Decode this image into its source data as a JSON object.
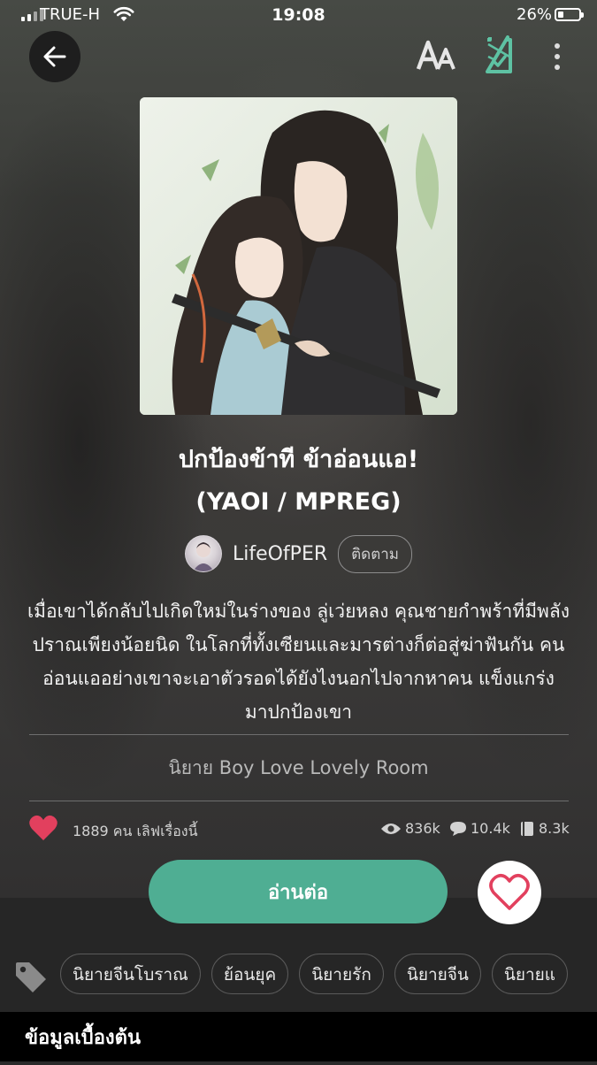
{
  "status_bar": {
    "carrier": "TRUE-H",
    "time": "19:08",
    "battery_percent": "26%",
    "battery_level": 0.26
  },
  "top_bar": {
    "back_icon": "arrow-left-icon",
    "font_icon": "font-size-icon",
    "save_icon": "bookmark-check-icon",
    "more_icon": "more-vertical-icon"
  },
  "book": {
    "title_line1": "ปกป้องข้าที ข้าอ่อนแอ!",
    "title_line2": "(YAOI / MPREG)",
    "author": "LifeOfPER",
    "follow_label": "ติดตาม",
    "synopsis": "เมื่อเขาได้กลับไปเกิดใหม่ในร่างของ ลู่เว่ยหลง คุณชายกำพร้าที่มีพลังปราณเพียงน้อยนิด ในโลกที่ทั้งเซียนและมารต่างก็ต่อสู่ฆ่าฟันกัน คนอ่อนแออย่างเขาจะเอาตัวรอดได้ยังไงนอกไปจากหาคน แข็งแกร่ง มาปกป้องเขา",
    "category": "นิยาย Boy Love Lovely Room"
  },
  "stats": {
    "love_text": "1889 คน เลิฟเรื่องนี้",
    "views": "836k",
    "comments": "10.4k",
    "chapters": "8.3k"
  },
  "actions": {
    "read_label": "อ่านต่อ",
    "favorite_icon": "heart-outline-icon"
  },
  "tags": [
    "นิยายจีนโบราณ",
    "ย้อนยุค",
    "นิยายรัก",
    "นิยายจีน",
    "นิยายแ"
  ],
  "section": {
    "title": "ข้อมูลเบื้องต้น"
  },
  "colors": {
    "accent": "#4fae93",
    "heart": "#e2405e",
    "save_icon": "#5ec2a3"
  }
}
